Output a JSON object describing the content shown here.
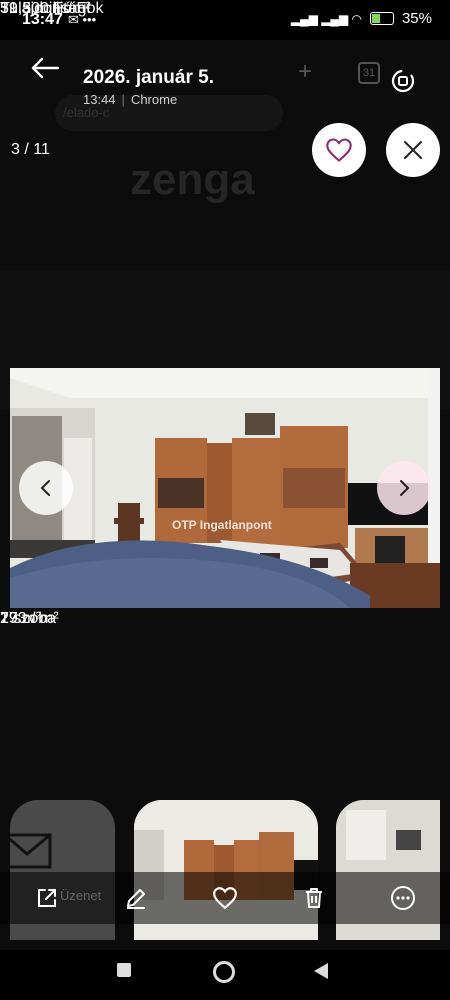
{
  "status_bar": {
    "time": "13:47",
    "battery": "35%"
  },
  "header": {
    "date": "2026. január 5.",
    "time": "13:44",
    "app": "Chrome",
    "url_fragment": "/elado-c"
  },
  "viewer": {
    "counter": "3 / 11"
  },
  "background_page": {
    "logo": "zenga",
    "area": "77 m²",
    "lot": "193 / m²",
    "rooms": "2 szoba",
    "price": "39,5 millió Ft",
    "price_per_m2": "51 300 Ft/m²",
    "properties_link": "Tulajdonságok"
  },
  "watermark": "OTP Ingatlanpont",
  "thumb_label": "Üzenet",
  "icons": [
    "back-arrow-icon",
    "heart-icon",
    "close-icon",
    "chevron-left-icon",
    "chevron-right-icon",
    "share-icon",
    "edit-icon",
    "heart-outline-icon",
    "trash-icon",
    "more-icon"
  ]
}
